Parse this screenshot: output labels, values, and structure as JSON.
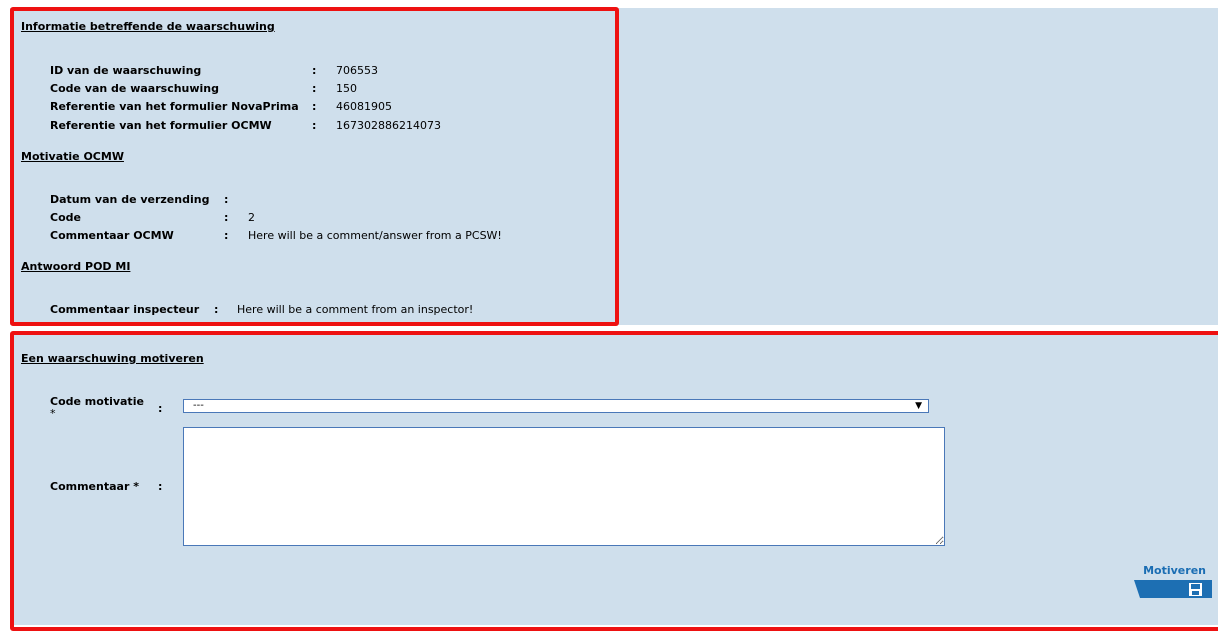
{
  "info_section": {
    "title": "Informatie betreffende de waarschuwing",
    "rows": [
      {
        "label": "ID van de waarschuwing",
        "value": "706553"
      },
      {
        "label": "Code van de waarschuwing",
        "value": "150"
      },
      {
        "label": "Referentie van het formulier NovaPrima",
        "value": "46081905"
      },
      {
        "label": "Referentie van het formulier OCMW",
        "value": "167302886214073"
      }
    ]
  },
  "motivatie_section": {
    "title": "Motivatie OCMW",
    "rows": [
      {
        "label": "Datum van de verzending",
        "value": ""
      },
      {
        "label": "Code",
        "value": "2"
      },
      {
        "label": "Commentaar OCMW",
        "value": "Here will be a comment/answer from a PCSW!"
      }
    ]
  },
  "antwoord_section": {
    "title": "Antwoord POD MI",
    "rows": [
      {
        "label": "Commentaar inspecteur",
        "value": "Here will be a comment from an inspector!"
      }
    ]
  },
  "form_section": {
    "title": "Een waarschuwing motiveren",
    "code_label": "Code motivatie",
    "code_required": "*",
    "code_selected": "---",
    "comment_label": "Commentaar *",
    "comment_value": "",
    "colon": ":",
    "submit_label": "Motiveren",
    "submit_icon": "save-disk-icon"
  },
  "colors": {
    "panel_background": "#cfdfec",
    "highlight_border": "#ee1111",
    "accent_blue": "#1a6db3"
  }
}
